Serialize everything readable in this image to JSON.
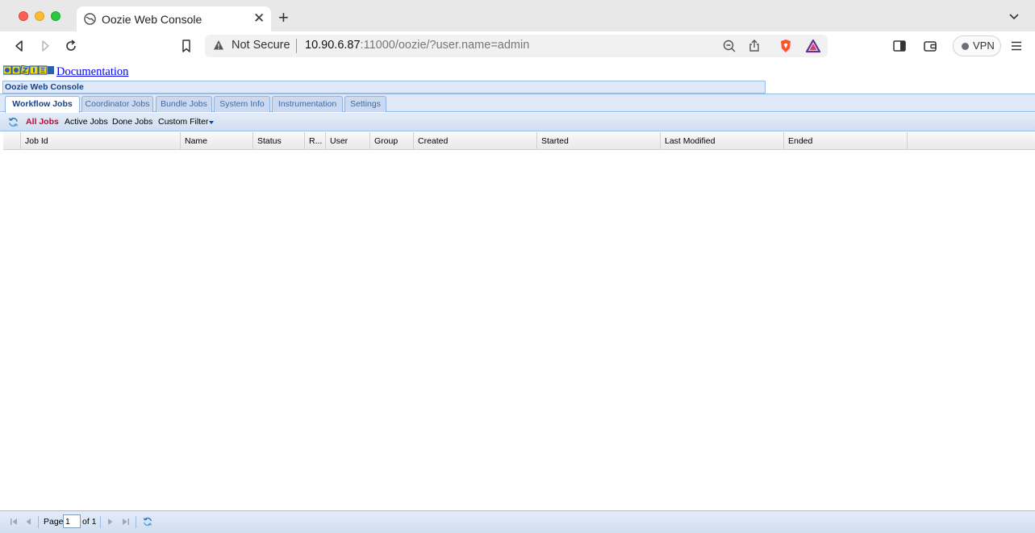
{
  "browser": {
    "tab_title": "Oozie Web Console",
    "security_label": "Not Secure",
    "url_host": "10.90.6.87",
    "url_rest": ":11000/oozie/?user.name=admin",
    "vpn_label": "VPN"
  },
  "page": {
    "doc_link": "Documentation",
    "console_title": "Oozie Web Console",
    "tabs": [
      {
        "label": "Workflow Jobs",
        "active": true
      },
      {
        "label": "Coordinator Jobs",
        "active": false
      },
      {
        "label": "Bundle Jobs",
        "active": false
      },
      {
        "label": "System Info",
        "active": false
      },
      {
        "label": "Instrumentation",
        "active": false
      },
      {
        "label": "Settings",
        "active": false
      }
    ],
    "filters": {
      "all_jobs": "All Jobs",
      "active_jobs": "Active Jobs",
      "done_jobs": "Done Jobs",
      "custom_filter": "Custom Filter"
    },
    "columns": [
      "Job Id",
      "Name",
      "Status",
      "R...",
      "User",
      "Group",
      "Created",
      "Started",
      "Last Modified",
      "Ended"
    ],
    "pager": {
      "page_label": "Page",
      "page_value": "1",
      "of_label": "of 1"
    }
  },
  "colors": {
    "accent": "#15428b",
    "selected_filter": "#cc0033",
    "panel_bg": "#dfe8f6"
  }
}
